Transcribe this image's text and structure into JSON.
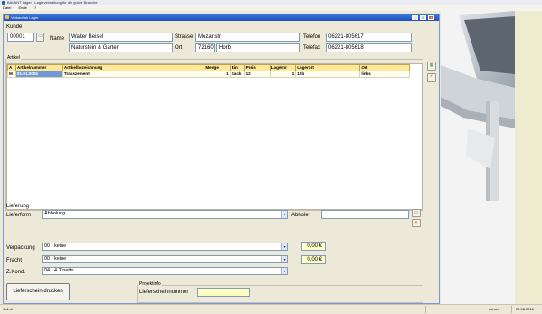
{
  "app": {
    "title": "BALANT Lager - Lagerverwaltung für die grüne Branche",
    "menu": [
      "Datei",
      "Ende",
      "?"
    ]
  },
  "window": {
    "title": "Verkauf ab Lager"
  },
  "kunde": {
    "section_label": "Kunde",
    "number": "00001",
    "name_label": "Name",
    "name_line1": "Walter Beisel",
    "name_line2": "Naturstein & Garten",
    "strasse_label": "Strasse",
    "strasse": "Mozartstr",
    "ort_label": "Ort",
    "plz": "72160",
    "ort": "Horb",
    "telefon_label": "Telefon",
    "telefon": "06221-805617",
    "telefax_label": "Telefax",
    "telefax": "06221-805618"
  },
  "artikel": {
    "group_title": "Artikel",
    "columns": [
      "A",
      "Artikelnummer",
      "Artikelbezeichnung",
      "Menge",
      "Ein",
      "Preis",
      "Lagernr",
      "Lagerort",
      "Ort"
    ],
    "rows": [
      {
        "a": "M",
        "artikelnummer": "01.01.0005",
        "bezeichnung": "Trasszement",
        "menge": "1",
        "ein": "Sack",
        "preis": "12",
        "lagernr": "1",
        "lagerort": "12b",
        "ort": "links"
      }
    ]
  },
  "lieferung": {
    "section_label": "Lieferung",
    "lieferform_label": "Lieferform",
    "lieferform": "Abholung",
    "abholer_label": "Abholer",
    "abholer": ""
  },
  "kosten": {
    "verpackung_label": "Verpackung",
    "verpackung": "00 - keine",
    "verpackung_betrag": "0,00 €",
    "fracht_label": "Fracht",
    "fracht": "00 - keine",
    "fracht_betrag": "0,00 €",
    "zkond_label": "Z.Kond.",
    "zkond": "04 - 4 T netto"
  },
  "projektinfo": {
    "title": "Projektinfo",
    "lieferscheinnummer_label": "Lieferscheinnummer",
    "lieferscheinnummer": ""
  },
  "buttons": {
    "lieferschein_drucken": "Lieferschein drucken"
  },
  "statusbar": {
    "left": "1 di di",
    "user": "admin",
    "date": "29.08.2016"
  }
}
